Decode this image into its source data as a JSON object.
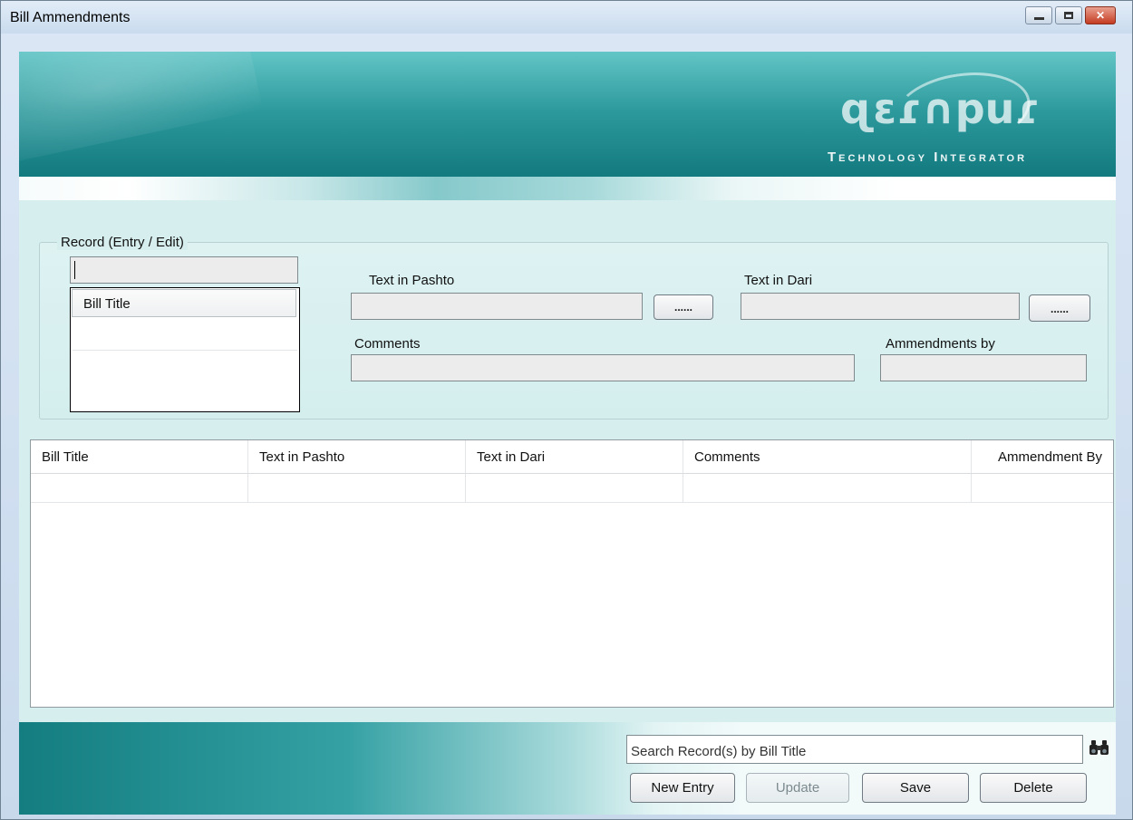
{
  "window": {
    "title": "Bill Ammendments"
  },
  "banner": {
    "logo_word": "ɋɛɾ∩puɾ",
    "logo_tagline": "Technology Integrator"
  },
  "record_group": {
    "legend": "Record (Entry / Edit)"
  },
  "left_input": {
    "value": ""
  },
  "listbox": {
    "header": "Bill Title"
  },
  "fields": {
    "pashto_label": "Text in Pashto",
    "pashto_value": "",
    "pashto_button": "......",
    "dari_label": "Text in Dari",
    "dari_value": "",
    "dari_button": "......",
    "comments_label": "Comments",
    "comments_value": "",
    "ammendments_label": "Ammendments by",
    "ammendments_value": ""
  },
  "grid": {
    "columns": [
      "Bill Title",
      "Text in Pashto",
      "Text in Dari",
      "Comments",
      "Ammendment By"
    ],
    "rows": [
      [
        "",
        "",
        "",
        "",
        ""
      ]
    ]
  },
  "footer": {
    "search_placeholder": "Search Record(s) by Bill Title",
    "search_icon": "binoculars-icon",
    "buttons": {
      "new_entry": "New Entry",
      "update": "Update",
      "save": "Save",
      "delete": "Delete"
    }
  },
  "colors": {
    "banner_dark": "#137a7f",
    "banner_light": "#63c5c6",
    "client_bg": "#d7eeee"
  }
}
